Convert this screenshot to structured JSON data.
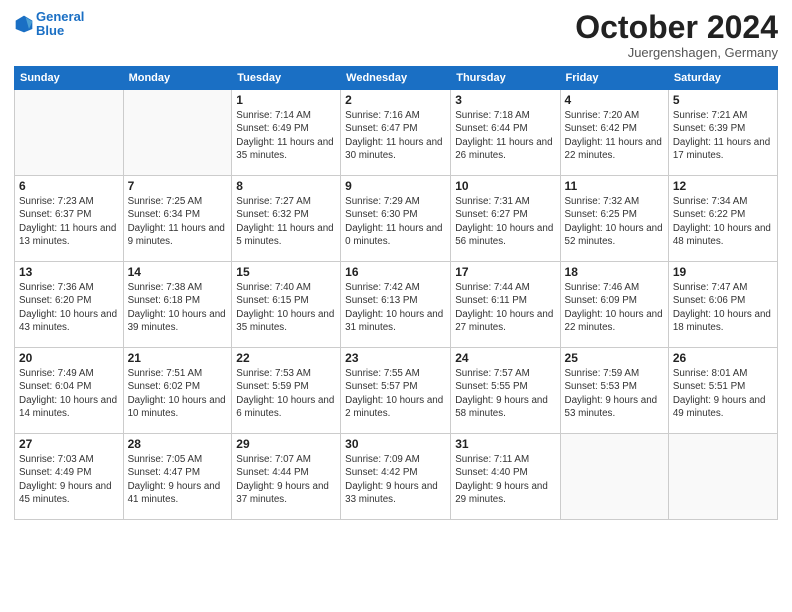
{
  "header": {
    "logo_line1": "General",
    "logo_line2": "Blue",
    "month_title": "October 2024",
    "location": "Juergenshagen, Germany"
  },
  "days_of_week": [
    "Sunday",
    "Monday",
    "Tuesday",
    "Wednesday",
    "Thursday",
    "Friday",
    "Saturday"
  ],
  "weeks": [
    [
      {
        "day": "",
        "sunrise": "",
        "sunset": "",
        "daylight": ""
      },
      {
        "day": "",
        "sunrise": "",
        "sunset": "",
        "daylight": ""
      },
      {
        "day": "1",
        "sunrise": "Sunrise: 7:14 AM",
        "sunset": "Sunset: 6:49 PM",
        "daylight": "Daylight: 11 hours and 35 minutes."
      },
      {
        "day": "2",
        "sunrise": "Sunrise: 7:16 AM",
        "sunset": "Sunset: 6:47 PM",
        "daylight": "Daylight: 11 hours and 30 minutes."
      },
      {
        "day": "3",
        "sunrise": "Sunrise: 7:18 AM",
        "sunset": "Sunset: 6:44 PM",
        "daylight": "Daylight: 11 hours and 26 minutes."
      },
      {
        "day": "4",
        "sunrise": "Sunrise: 7:20 AM",
        "sunset": "Sunset: 6:42 PM",
        "daylight": "Daylight: 11 hours and 22 minutes."
      },
      {
        "day": "5",
        "sunrise": "Sunrise: 7:21 AM",
        "sunset": "Sunset: 6:39 PM",
        "daylight": "Daylight: 11 hours and 17 minutes."
      }
    ],
    [
      {
        "day": "6",
        "sunrise": "Sunrise: 7:23 AM",
        "sunset": "Sunset: 6:37 PM",
        "daylight": "Daylight: 11 hours and 13 minutes."
      },
      {
        "day": "7",
        "sunrise": "Sunrise: 7:25 AM",
        "sunset": "Sunset: 6:34 PM",
        "daylight": "Daylight: 11 hours and 9 minutes."
      },
      {
        "day": "8",
        "sunrise": "Sunrise: 7:27 AM",
        "sunset": "Sunset: 6:32 PM",
        "daylight": "Daylight: 11 hours and 5 minutes."
      },
      {
        "day": "9",
        "sunrise": "Sunrise: 7:29 AM",
        "sunset": "Sunset: 6:30 PM",
        "daylight": "Daylight: 11 hours and 0 minutes."
      },
      {
        "day": "10",
        "sunrise": "Sunrise: 7:31 AM",
        "sunset": "Sunset: 6:27 PM",
        "daylight": "Daylight: 10 hours and 56 minutes."
      },
      {
        "day": "11",
        "sunrise": "Sunrise: 7:32 AM",
        "sunset": "Sunset: 6:25 PM",
        "daylight": "Daylight: 10 hours and 52 minutes."
      },
      {
        "day": "12",
        "sunrise": "Sunrise: 7:34 AM",
        "sunset": "Sunset: 6:22 PM",
        "daylight": "Daylight: 10 hours and 48 minutes."
      }
    ],
    [
      {
        "day": "13",
        "sunrise": "Sunrise: 7:36 AM",
        "sunset": "Sunset: 6:20 PM",
        "daylight": "Daylight: 10 hours and 43 minutes."
      },
      {
        "day": "14",
        "sunrise": "Sunrise: 7:38 AM",
        "sunset": "Sunset: 6:18 PM",
        "daylight": "Daylight: 10 hours and 39 minutes."
      },
      {
        "day": "15",
        "sunrise": "Sunrise: 7:40 AM",
        "sunset": "Sunset: 6:15 PM",
        "daylight": "Daylight: 10 hours and 35 minutes."
      },
      {
        "day": "16",
        "sunrise": "Sunrise: 7:42 AM",
        "sunset": "Sunset: 6:13 PM",
        "daylight": "Daylight: 10 hours and 31 minutes."
      },
      {
        "day": "17",
        "sunrise": "Sunrise: 7:44 AM",
        "sunset": "Sunset: 6:11 PM",
        "daylight": "Daylight: 10 hours and 27 minutes."
      },
      {
        "day": "18",
        "sunrise": "Sunrise: 7:46 AM",
        "sunset": "Sunset: 6:09 PM",
        "daylight": "Daylight: 10 hours and 22 minutes."
      },
      {
        "day": "19",
        "sunrise": "Sunrise: 7:47 AM",
        "sunset": "Sunset: 6:06 PM",
        "daylight": "Daylight: 10 hours and 18 minutes."
      }
    ],
    [
      {
        "day": "20",
        "sunrise": "Sunrise: 7:49 AM",
        "sunset": "Sunset: 6:04 PM",
        "daylight": "Daylight: 10 hours and 14 minutes."
      },
      {
        "day": "21",
        "sunrise": "Sunrise: 7:51 AM",
        "sunset": "Sunset: 6:02 PM",
        "daylight": "Daylight: 10 hours and 10 minutes."
      },
      {
        "day": "22",
        "sunrise": "Sunrise: 7:53 AM",
        "sunset": "Sunset: 5:59 PM",
        "daylight": "Daylight: 10 hours and 6 minutes."
      },
      {
        "day": "23",
        "sunrise": "Sunrise: 7:55 AM",
        "sunset": "Sunset: 5:57 PM",
        "daylight": "Daylight: 10 hours and 2 minutes."
      },
      {
        "day": "24",
        "sunrise": "Sunrise: 7:57 AM",
        "sunset": "Sunset: 5:55 PM",
        "daylight": "Daylight: 9 hours and 58 minutes."
      },
      {
        "day": "25",
        "sunrise": "Sunrise: 7:59 AM",
        "sunset": "Sunset: 5:53 PM",
        "daylight": "Daylight: 9 hours and 53 minutes."
      },
      {
        "day": "26",
        "sunrise": "Sunrise: 8:01 AM",
        "sunset": "Sunset: 5:51 PM",
        "daylight": "Daylight: 9 hours and 49 minutes."
      }
    ],
    [
      {
        "day": "27",
        "sunrise": "Sunrise: 7:03 AM",
        "sunset": "Sunset: 4:49 PM",
        "daylight": "Daylight: 9 hours and 45 minutes."
      },
      {
        "day": "28",
        "sunrise": "Sunrise: 7:05 AM",
        "sunset": "Sunset: 4:47 PM",
        "daylight": "Daylight: 9 hours and 41 minutes."
      },
      {
        "day": "29",
        "sunrise": "Sunrise: 7:07 AM",
        "sunset": "Sunset: 4:44 PM",
        "daylight": "Daylight: 9 hours and 37 minutes."
      },
      {
        "day": "30",
        "sunrise": "Sunrise: 7:09 AM",
        "sunset": "Sunset: 4:42 PM",
        "daylight": "Daylight: 9 hours and 33 minutes."
      },
      {
        "day": "31",
        "sunrise": "Sunrise: 7:11 AM",
        "sunset": "Sunset: 4:40 PM",
        "daylight": "Daylight: 9 hours and 29 minutes."
      },
      {
        "day": "",
        "sunrise": "",
        "sunset": "",
        "daylight": ""
      },
      {
        "day": "",
        "sunrise": "",
        "sunset": "",
        "daylight": ""
      }
    ]
  ]
}
